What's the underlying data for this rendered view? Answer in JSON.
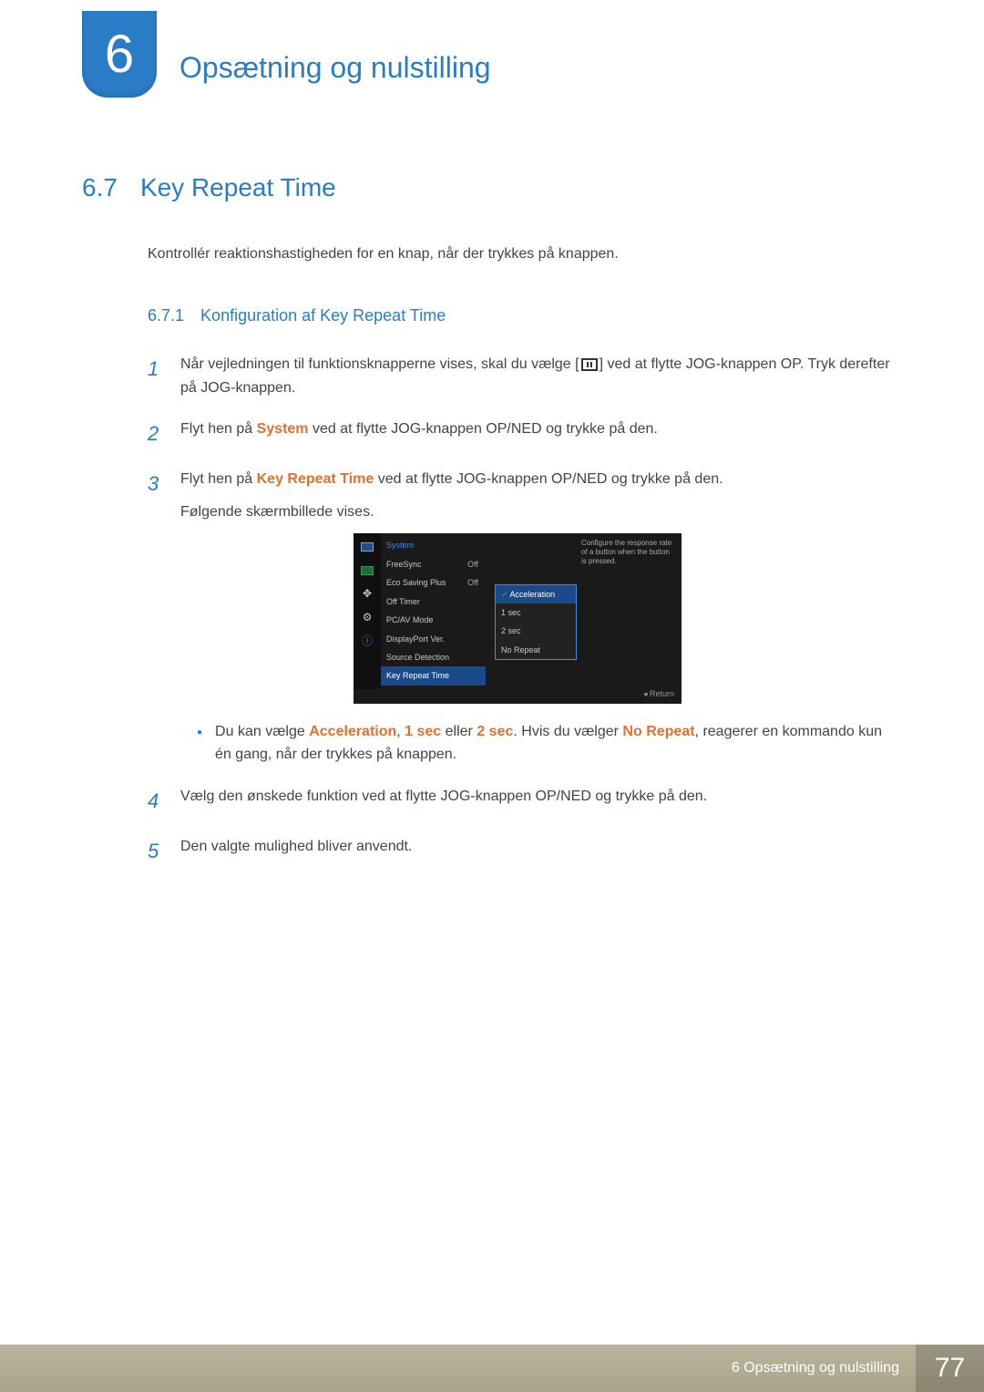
{
  "chapter": {
    "number": "6",
    "title": "Opsætning og nulstilling"
  },
  "section": {
    "number": "6.7",
    "title": "Key Repeat Time"
  },
  "intro": "Kontrollér reaktionshastigheden for en knap, når der trykkes på knappen.",
  "subsection": {
    "number": "6.7.1",
    "title": "Konfiguration af Key Repeat Time"
  },
  "steps": {
    "s1": {
      "num": "1",
      "a": "Når vejledningen til funktionsknapperne vises, skal du vælge [",
      "b": "] ved at flytte JOG-knappen OP. Tryk derefter på JOG-knappen."
    },
    "s2": {
      "num": "2",
      "a": "Flyt hen på ",
      "hl": "System",
      "b": " ved at flytte JOG-knappen OP/NED og trykke på den."
    },
    "s3": {
      "num": "3",
      "a": "Flyt hen på ",
      "hl": "Key Repeat Time",
      "b": " ved at flytte JOG-knappen OP/NED og trykke på den.",
      "c": "Følgende skærmbillede vises."
    },
    "bullet": {
      "a": "Du kan vælge ",
      "h1": "Acceleration",
      "b": ", ",
      "h2": "1 sec",
      "c": " eller ",
      "h3": "2 sec",
      "d": ". Hvis du vælger ",
      "h4": "No Repeat",
      "e": ", reagerer en kommando kun én gang, når der trykkes på knappen."
    },
    "s4": {
      "num": "4",
      "text": "Vælg den ønskede funktion ved at flytte JOG-knappen OP/NED og trykke på den."
    },
    "s5": {
      "num": "5",
      "text": "Den valgte mulighed bliver anvendt."
    }
  },
  "osd": {
    "heading": "System",
    "items": [
      {
        "label": "FreeSync",
        "value": "Off"
      },
      {
        "label": "Eco Saving Plus",
        "value": "Off"
      },
      {
        "label": "Off Timer",
        "value": ""
      },
      {
        "label": "PC/AV Mode",
        "value": ""
      },
      {
        "label": "DisplayPort Ver.",
        "value": ""
      },
      {
        "label": "Source Detection",
        "value": ""
      },
      {
        "label": "Key Repeat Time",
        "value": ""
      }
    ],
    "popup": [
      "Acceleration",
      "1 sec",
      "2 sec",
      "No Repeat"
    ],
    "desc": "Configure the response rate of a button when the button is pressed.",
    "return": "Return"
  },
  "footer": {
    "text": "6 Opsætning og nulstilling",
    "page": "77"
  }
}
